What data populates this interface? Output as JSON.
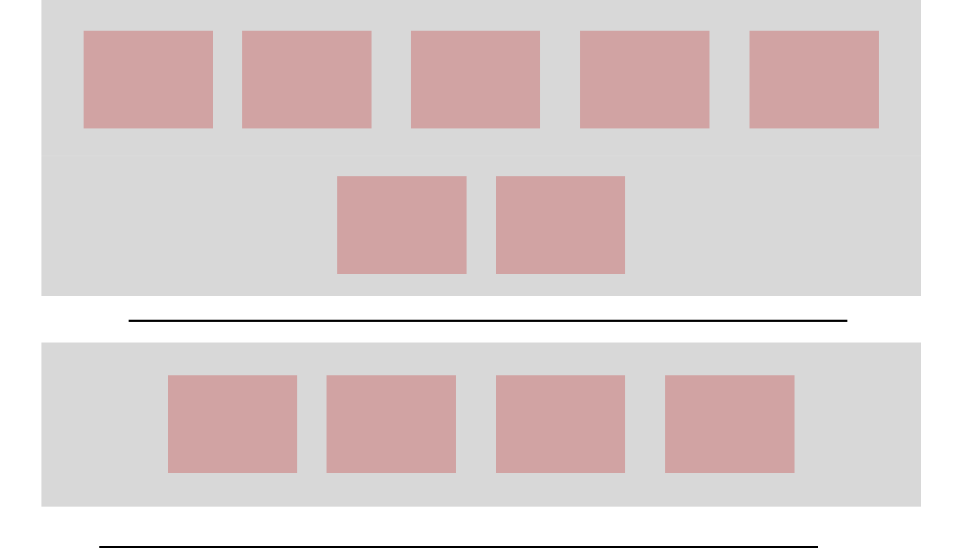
{
  "colors": {
    "panel": "#d8d8d8",
    "tile": "#d1a3a3",
    "rule": "#000000",
    "background": "#ffffff"
  },
  "sections": [
    {
      "name": "top-gallery",
      "tile_count": 7
    },
    {
      "name": "bottom-gallery",
      "tile_count": 4
    }
  ]
}
